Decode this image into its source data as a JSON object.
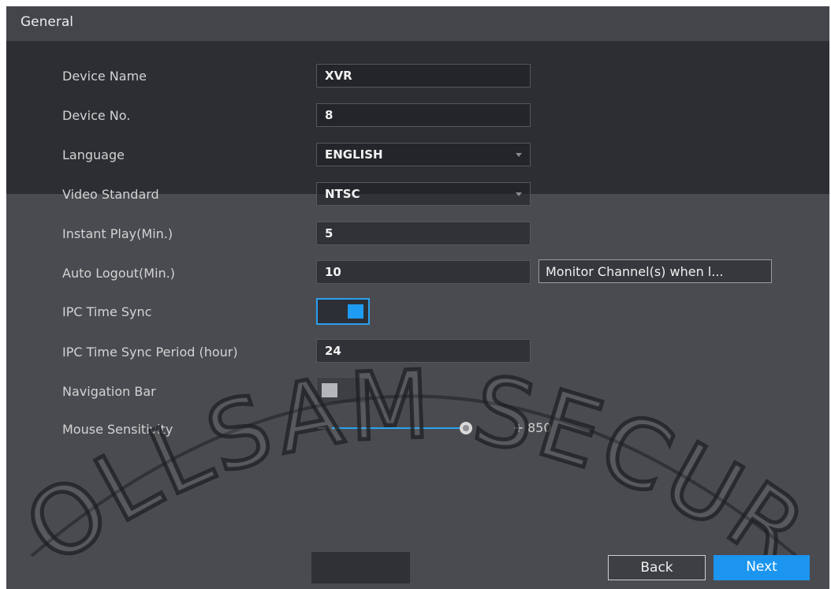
{
  "header": {
    "title": "General"
  },
  "form": {
    "device_name": {
      "label": "Device Name",
      "value": "XVR"
    },
    "device_no": {
      "label": "Device No.",
      "value": "8"
    },
    "language": {
      "label": "Language",
      "value": "ENGLISH"
    },
    "video_standard": {
      "label": "Video Standard",
      "value": "NTSC"
    },
    "instant_play": {
      "label": "Instant Play(Min.)",
      "value": "5"
    },
    "auto_logout": {
      "label": "Auto Logout(Min.)",
      "value": "10",
      "button_label": "Monitor Channel(s) when l..."
    },
    "ipc_time_sync": {
      "label": "IPC Time Sync",
      "enabled": true
    },
    "ipc_time_sync_period": {
      "label": "IPC Time Sync Period (hour)",
      "value": "24"
    },
    "navigation_bar": {
      "label": "Navigation Bar",
      "enabled": false
    },
    "mouse_sensitivity": {
      "label": "Mouse Sensitivity",
      "minus": "–",
      "plus": "+",
      "value": "850",
      "fraction": 0.85
    }
  },
  "footer": {
    "back_label": "Back",
    "next_label": "Next"
  },
  "watermark": {
    "text": "OLLSAM SECURITY"
  },
  "colors": {
    "accent": "#1b95ef",
    "panel": "#3b3d43",
    "header": "#43454b"
  },
  "icons": {
    "dropdown": "caret-down-icon",
    "slider_thumb": "slider-thumb-icon"
  }
}
